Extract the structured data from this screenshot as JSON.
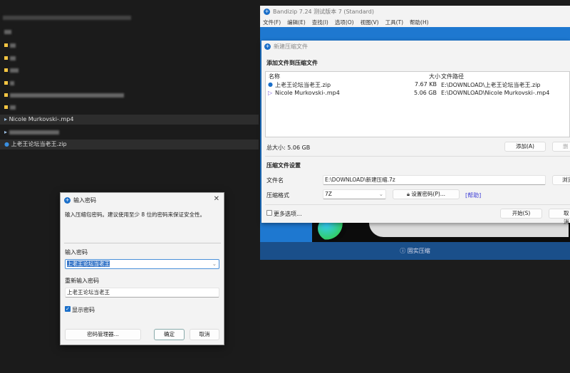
{
  "explorer": {
    "items": [
      {
        "name": "Nicole Murkovski-.mp4",
        "selected": true
      },
      {
        "name": "上老王论坛当老王.zip",
        "selected": true
      }
    ]
  },
  "bandizip": {
    "title": "Bandizip 7.24 测试版本 7 (Standard)",
    "menu": [
      "文件(F)",
      "编辑(E)",
      "查找(I)",
      "选项(O)",
      "视图(V)",
      "工具(T)",
      "帮助(H)"
    ],
    "solid_label": "固实压缩"
  },
  "new_archive": {
    "title": "新建压缩文件",
    "section_add": "添加文件到压缩文件",
    "columns": {
      "name": "名称",
      "size": "大小",
      "path": "文件路径"
    },
    "files": [
      {
        "name": "上老王论坛当老王.zip",
        "size": "7.67 KB",
        "path": "E:\\DOWNLOAD\\上老王论坛当老王.zip",
        "icon": "zip-icon"
      },
      {
        "name": "Nicole Murkovski-.mp4",
        "size": "5.06 GB",
        "path": "E:\\DOWNLOAD\\Nicole Murkovski-.mp4",
        "icon": "video-icon"
      }
    ],
    "total_size": "总大小: 5.06 GB",
    "add_button": "添加(A)",
    "delete_button": "删",
    "section_settings": "压缩文件设置",
    "filename_label": "文件名",
    "filename_value": "E:\\DOWNLOAD\\新建压缩.7z",
    "browse_button": "浏览",
    "format_label": "压缩格式",
    "format_value": "7Z",
    "set_password_button": "设置密码(P)...",
    "help_link": "[帮助]",
    "more_options": "更多选项...",
    "start_button": "开始(S)",
    "cancel_button": "取消"
  },
  "password_dialog": {
    "title": "输入密码",
    "description": "输入压缩包密码。建议使用至少 8 位的密码来保证安全性。",
    "password_label": "输入密码",
    "password_value": "上老王论坛当老王",
    "confirm_label": "重新输入密码",
    "confirm_value": "上老王论坛当老王",
    "show_password": "显示密码",
    "show_password_checked": true,
    "manager_button": "密码管理器...",
    "ok_button": "确定",
    "cancel_button": "取消"
  },
  "colors": {
    "accent": "#1e78d0",
    "link": "#3b3bd6"
  }
}
